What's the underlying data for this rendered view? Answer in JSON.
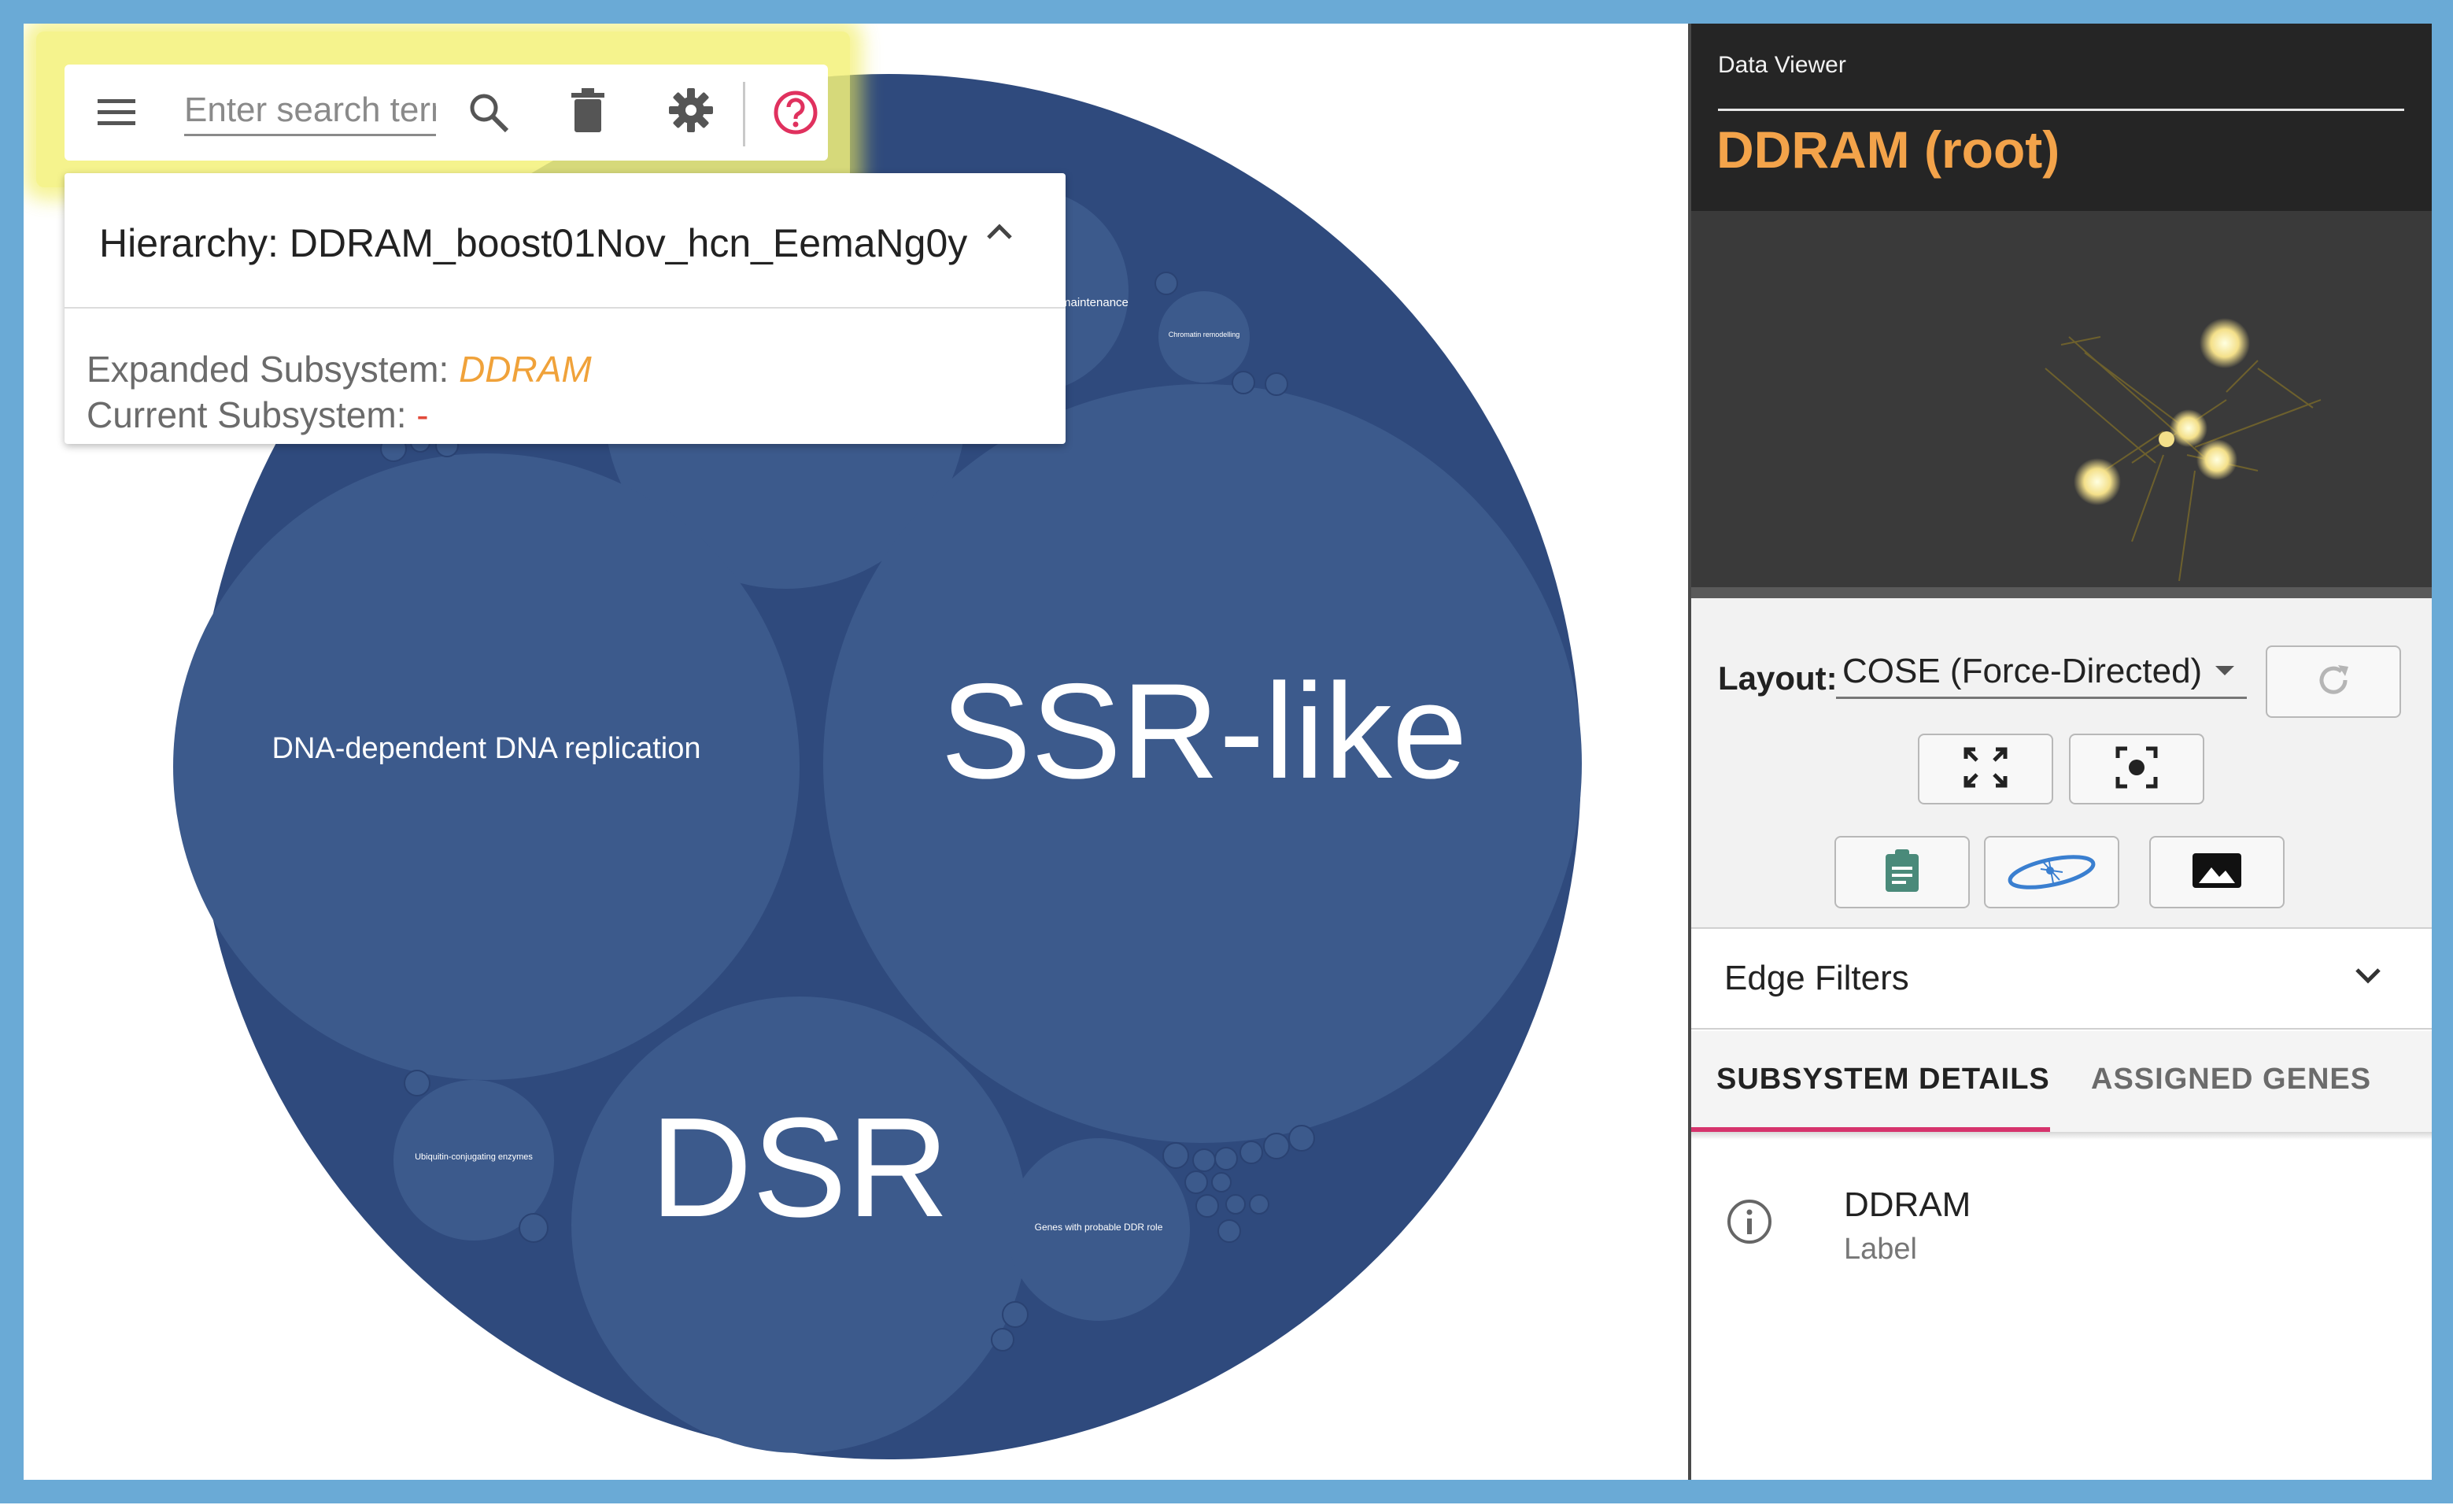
{
  "toolbar": {
    "search_placeholder": "Enter search terms",
    "icons": [
      "menu-icon",
      "search-icon",
      "trash-icon",
      "gear-icon",
      "help-icon"
    ],
    "help_color": "#e0315e"
  },
  "hierarchy": {
    "title": "Hierarchy: DDRAM_boost01Nov_hcn_EemaNg0y",
    "expanded_label": "Expanded Subsystem:",
    "expanded_value": "DDRAM",
    "current_label": "Current Subsystem:",
    "current_value": "-"
  },
  "circles": {
    "large_labels": {
      "ssr": "SSR-like",
      "dsr": "DSR",
      "dna": "DNA-dependent DNA replication"
    },
    "small_labels": {
      "maintenance": "maintenance",
      "chromatin": "Chromatin remodelling",
      "ubiquitin": "Ubiquitin-conjugating enzymes",
      "genes_ddr": "Genes with probable DDR role"
    },
    "colors": {
      "outer": "#2f4a7d",
      "inner": "#3c5a8c",
      "label": "#ffffff"
    }
  },
  "viewer": {
    "section_label": "Data Viewer",
    "title": "DDRAM (root)",
    "title_color": "#f3a34a",
    "layout_label": "Layout:",
    "layout_value": "COSE (Force-Directed)",
    "buttons": [
      "refresh-icon",
      "fit-icon",
      "center-focus-icon",
      "clipboard-icon",
      "network-icon",
      "image-icon"
    ],
    "edge_filters_label": "Edge Filters",
    "tabs": [
      "SUBSYSTEM DETAILS",
      "ASSIGNED GENES"
    ],
    "active_tab": "SUBSYSTEM DETAILS",
    "detail": {
      "name": "DDRAM",
      "sub": "Label"
    }
  }
}
